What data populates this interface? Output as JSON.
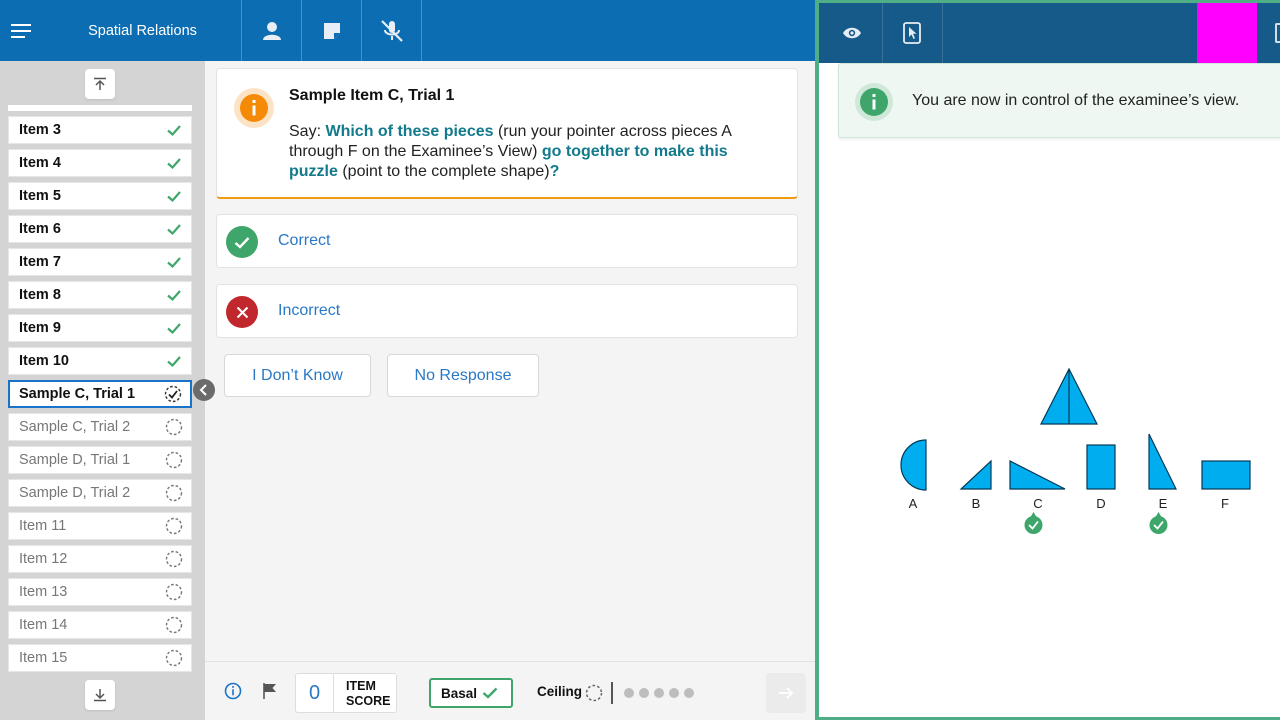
{
  "header": {
    "title": "Spatial Relations",
    "icons": [
      "hamburger-menu-icon",
      "person-icon",
      "note-icon",
      "mic-off-icon"
    ]
  },
  "sidebar": {
    "items": [
      {
        "label": "Item 3",
        "status": "done"
      },
      {
        "label": "Item 4",
        "status": "done"
      },
      {
        "label": "Item 5",
        "status": "done"
      },
      {
        "label": "Item 6",
        "status": "done"
      },
      {
        "label": "Item 7",
        "status": "done"
      },
      {
        "label": "Item 8",
        "status": "done"
      },
      {
        "label": "Item 9",
        "status": "done"
      },
      {
        "label": "Item 10",
        "status": "done"
      },
      {
        "label": "Sample C, Trial 1",
        "status": "current"
      },
      {
        "label": "Sample C, Trial 2",
        "status": "pending"
      },
      {
        "label": "Sample D, Trial 1",
        "status": "pending"
      },
      {
        "label": "Sample D, Trial 2",
        "status": "pending"
      },
      {
        "label": "Item 11",
        "status": "pending"
      },
      {
        "label": "Item 12",
        "status": "pending"
      },
      {
        "label": "Item 13",
        "status": "pending"
      },
      {
        "label": "Item 14",
        "status": "pending"
      },
      {
        "label": "Item 15",
        "status": "pending"
      }
    ]
  },
  "prompt": {
    "title": "Sample Item C, Trial 1",
    "say": "Say:",
    "q1": "Which of these pieces",
    "t1": "(run your pointer across pieces A through F on the Examinee’s View)",
    "q2": "go together to make this puzzle",
    "t2": "(point to the complete shape)",
    "q3": "?"
  },
  "responses": {
    "correct": "Correct",
    "incorrect": "Incorrect"
  },
  "buttons": {
    "dont_know": "I Don’t Know",
    "no_response": "No Response"
  },
  "footer": {
    "item_score_value": "0",
    "item_score_label_1": "ITEM",
    "item_score_label_2": "SCORE",
    "basal": "Basal",
    "ceiling": "Ceiling",
    "progress_dots": 5
  },
  "examinee_view": {
    "notice": "You are now in control of the examinee’s view.",
    "pieces": [
      {
        "label": "A",
        "selected": false
      },
      {
        "label": "B",
        "selected": false
      },
      {
        "label": "C",
        "selected": true
      },
      {
        "label": "D",
        "selected": false
      },
      {
        "label": "E",
        "selected": true
      },
      {
        "label": "F",
        "selected": false
      }
    ],
    "colors": {
      "piece_fill": "#00aeef",
      "magenta_block": "#ff00ff",
      "accent_green": "#3fa66b",
      "header_blue": "#0d6db3"
    }
  }
}
